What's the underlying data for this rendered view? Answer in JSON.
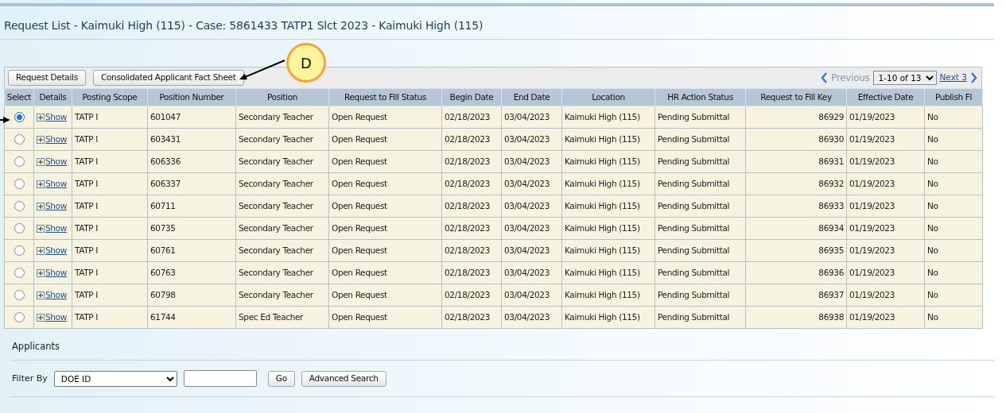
{
  "title": "Request List - Kaimuki High (115) - Case: 5861433 TATP1 Slct 2023 - Kaimuki High (115)",
  "toolbar": {
    "buttons": [
      "Request Details",
      "Consolidated Applicant Fact Sheet"
    ],
    "pager": {
      "previous": "Previous",
      "range": "1-10 of 13",
      "next": "Next 3"
    }
  },
  "callout": {
    "label": "D"
  },
  "table": {
    "control_columns": [
      "Select",
      "Details"
    ],
    "columns": [
      "Posting Scope",
      "Position Number",
      "Position",
      "Request to Fill Status",
      "Begin Date",
      "End Date",
      "Location",
      "HR Action Status",
      "Request to Fill Key",
      "Effective Date",
      "Publish Fl"
    ],
    "rows": [
      {
        "selected": true,
        "details": "Show",
        "cells": [
          "TATP I",
          "601047",
          "Secondary Teacher",
          "Open Request",
          "02/18/2023",
          "03/04/2023",
          "Kaimuki High (115)",
          "Pending Submittal",
          "86929",
          "01/19/2023",
          "No"
        ]
      },
      {
        "selected": false,
        "details": "Show",
        "cells": [
          "TATP I",
          "603431",
          "Secondary Teacher",
          "Open Request",
          "02/18/2023",
          "03/04/2023",
          "Kaimuki High (115)",
          "Pending Submittal",
          "86930",
          "01/19/2023",
          "No"
        ]
      },
      {
        "selected": false,
        "details": "Show",
        "cells": [
          "TATP I",
          "606336",
          "Secondary Teacher",
          "Open Request",
          "02/18/2023",
          "03/04/2023",
          "Kaimuki High (115)",
          "Pending Submittal",
          "86931",
          "01/19/2023",
          "No"
        ]
      },
      {
        "selected": false,
        "details": "Show",
        "cells": [
          "TATP I",
          "606337",
          "Secondary Teacher",
          "Open Request",
          "02/18/2023",
          "03/04/2023",
          "Kaimuki High (115)",
          "Pending Submittal",
          "86932",
          "01/19/2023",
          "No"
        ]
      },
      {
        "selected": false,
        "details": "Show",
        "cells": [
          "TATP I",
          "60711",
          "Secondary Teacher",
          "Open Request",
          "02/18/2023",
          "03/04/2023",
          "Kaimuki High (115)",
          "Pending Submittal",
          "86933",
          "01/19/2023",
          "No"
        ]
      },
      {
        "selected": false,
        "details": "Show",
        "cells": [
          "TATP I",
          "60735",
          "Secondary Teacher",
          "Open Request",
          "02/18/2023",
          "03/04/2023",
          "Kaimuki High (115)",
          "Pending Submittal",
          "86934",
          "01/19/2023",
          "No"
        ]
      },
      {
        "selected": false,
        "details": "Show",
        "cells": [
          "TATP I",
          "60761",
          "Secondary Teacher",
          "Open Request",
          "02/18/2023",
          "03/04/2023",
          "Kaimuki High (115)",
          "Pending Submittal",
          "86935",
          "01/19/2023",
          "No"
        ]
      },
      {
        "selected": false,
        "details": "Show",
        "cells": [
          "TATP I",
          "60763",
          "Secondary Teacher",
          "Open Request",
          "02/18/2023",
          "03/04/2023",
          "Kaimuki High (115)",
          "Pending Submittal",
          "86936",
          "01/19/2023",
          "No"
        ]
      },
      {
        "selected": false,
        "details": "Show",
        "cells": [
          "TATP I",
          "60798",
          "Secondary Teacher",
          "Open Request",
          "02/18/2023",
          "03/04/2023",
          "Kaimuki High (115)",
          "Pending Submittal",
          "86937",
          "01/19/2023",
          "No"
        ]
      },
      {
        "selected": false,
        "details": "Show",
        "cells": [
          "TATP I",
          "61744",
          "Spec Ed Teacher",
          "Open Request",
          "02/18/2023",
          "03/04/2023",
          "Kaimuki High (115)",
          "Pending Submittal",
          "86938",
          "01/19/2023",
          "No"
        ]
      }
    ]
  },
  "applicants": {
    "heading": "Applicants",
    "filter_label": "Filter By",
    "filter_value": "DOE ID",
    "go": "Go",
    "advanced": "Advanced Search"
  }
}
